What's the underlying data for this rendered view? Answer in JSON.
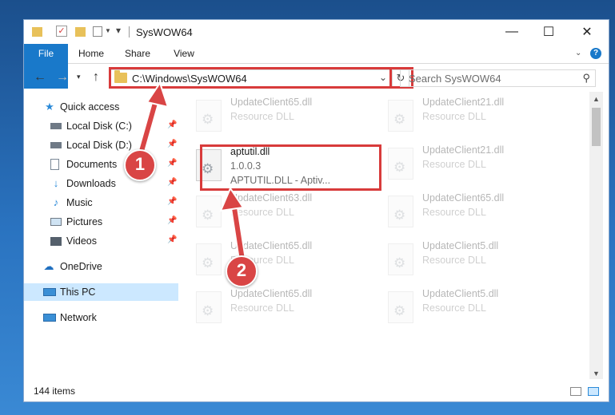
{
  "window": {
    "title": "SysWOW64",
    "controls": {
      "minimize": "—",
      "maximize": "☐",
      "close": "✕"
    }
  },
  "ribbon": {
    "tabs": [
      "File",
      "Home",
      "Share",
      "View"
    ],
    "help": "?"
  },
  "address": {
    "path": "C:\\Windows\\SysWOW64",
    "search_placeholder": "Search SysWOW64"
  },
  "nav": {
    "items": [
      {
        "label": "Quick access",
        "icon": "star-icon"
      },
      {
        "label": "Local Disk (C:)",
        "icon": "drive-icon",
        "pinned": true
      },
      {
        "label": "Local Disk (D:)",
        "icon": "drive-icon",
        "pinned": true
      },
      {
        "label": "Documents",
        "icon": "documents-icon",
        "pinned": true
      },
      {
        "label": "Downloads",
        "icon": "downloads-icon",
        "pinned": true
      },
      {
        "label": "Music",
        "icon": "music-icon",
        "pinned": true
      },
      {
        "label": "Pictures",
        "icon": "pictures-icon",
        "pinned": true
      },
      {
        "label": "Videos",
        "icon": "videos-icon",
        "pinned": true
      },
      {
        "label": "OneDrive",
        "icon": "cloud-icon"
      },
      {
        "label": "This PC",
        "icon": "computer-icon",
        "selected": true
      },
      {
        "label": "Network",
        "icon": "network-icon"
      }
    ]
  },
  "files": [
    {
      "name": "UpdateClient65.dll",
      "line2": "Resource DLL"
    },
    {
      "name": "UpdateClient21.dll",
      "line2": "Resource DLL"
    },
    {
      "name": "aptutil.dll",
      "line2": "1.0.0.3",
      "line3": "APTUTIL.DLL - Aptiv..."
    },
    {
      "name": "UpdateClient21.dll",
      "line2": "Resource DLL"
    },
    {
      "name": "UpdateClient63.dll",
      "line2": "Resource DLL"
    },
    {
      "name": "UpdateClient65.dll",
      "line2": "Resource DLL"
    },
    {
      "name": "UpdateClient65.dll",
      "line2": "Resource DLL"
    },
    {
      "name": "UpdateClient5.dll",
      "line2": "Resource DLL"
    },
    {
      "name": "UpdateClient65.dll",
      "line2": "Resource DLL"
    },
    {
      "name": "UpdateClient5.dll",
      "line2": "Resource DLL"
    }
  ],
  "status": {
    "item_count": "144 items"
  },
  "callouts": {
    "step1": "1",
    "step2": "2"
  },
  "colors": {
    "accent": "#1979ca",
    "highlight": "#d83b3b",
    "selection": "#cce8ff"
  }
}
